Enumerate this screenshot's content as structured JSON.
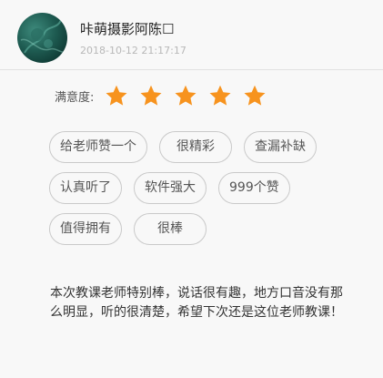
{
  "header": {
    "username": "咔萌摄影阿陈☐",
    "timestamp": "2018-10-12 21:17:17"
  },
  "rating": {
    "label": "满意度:",
    "value": 5,
    "max": 5,
    "star_color": "#f7931e"
  },
  "tags": [
    [
      "给老师赞一个",
      "很精彩",
      "查漏补缺"
    ],
    [
      "认真听了",
      "软件强大",
      "999个赞"
    ],
    [
      "值得拥有",
      "很棒"
    ]
  ],
  "comment": "本次教课老师特别棒，说话很有趣，地方口音没有那么明显，听的很清楚，希望下次还是这位老师教课！"
}
